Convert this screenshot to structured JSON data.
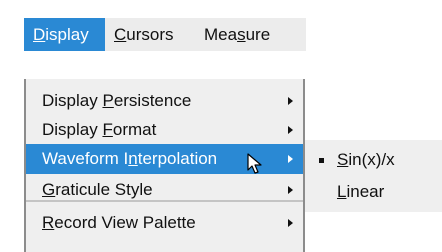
{
  "menubar": {
    "items": [
      {
        "pre": "",
        "u": "D",
        "post": "isplay"
      },
      {
        "pre": "",
        "u": "C",
        "post": "ursors"
      },
      {
        "pre": "Mea",
        "u": "s",
        "post": "ure"
      }
    ]
  },
  "menu": {
    "items": [
      {
        "pre": "Display ",
        "u": "P",
        "post": "ersistence"
      },
      {
        "pre": "Display ",
        "u": "F",
        "post": "ormat"
      },
      {
        "pre": "Waveform I",
        "u": "n",
        "post": "terpolation"
      },
      {
        "pre": "",
        "u": "G",
        "post": "raticule Style"
      },
      {
        "pre": "",
        "u": "R",
        "post": "ecord View Palette"
      }
    ]
  },
  "submenu": {
    "items": [
      {
        "pre": "",
        "u": "S",
        "post": "in(x)/x",
        "selected": true
      },
      {
        "pre": "",
        "u": "L",
        "post": "inear",
        "selected": false
      }
    ]
  },
  "colors": {
    "highlight": "#2a89d4",
    "menu_bg": "#efefef",
    "menubar_bg": "#ececec"
  },
  "icons": {
    "cursor": "pointer-cursor-icon",
    "submenu_arrow": "chevron-right-icon",
    "selected_bullet": "bullet-icon"
  }
}
